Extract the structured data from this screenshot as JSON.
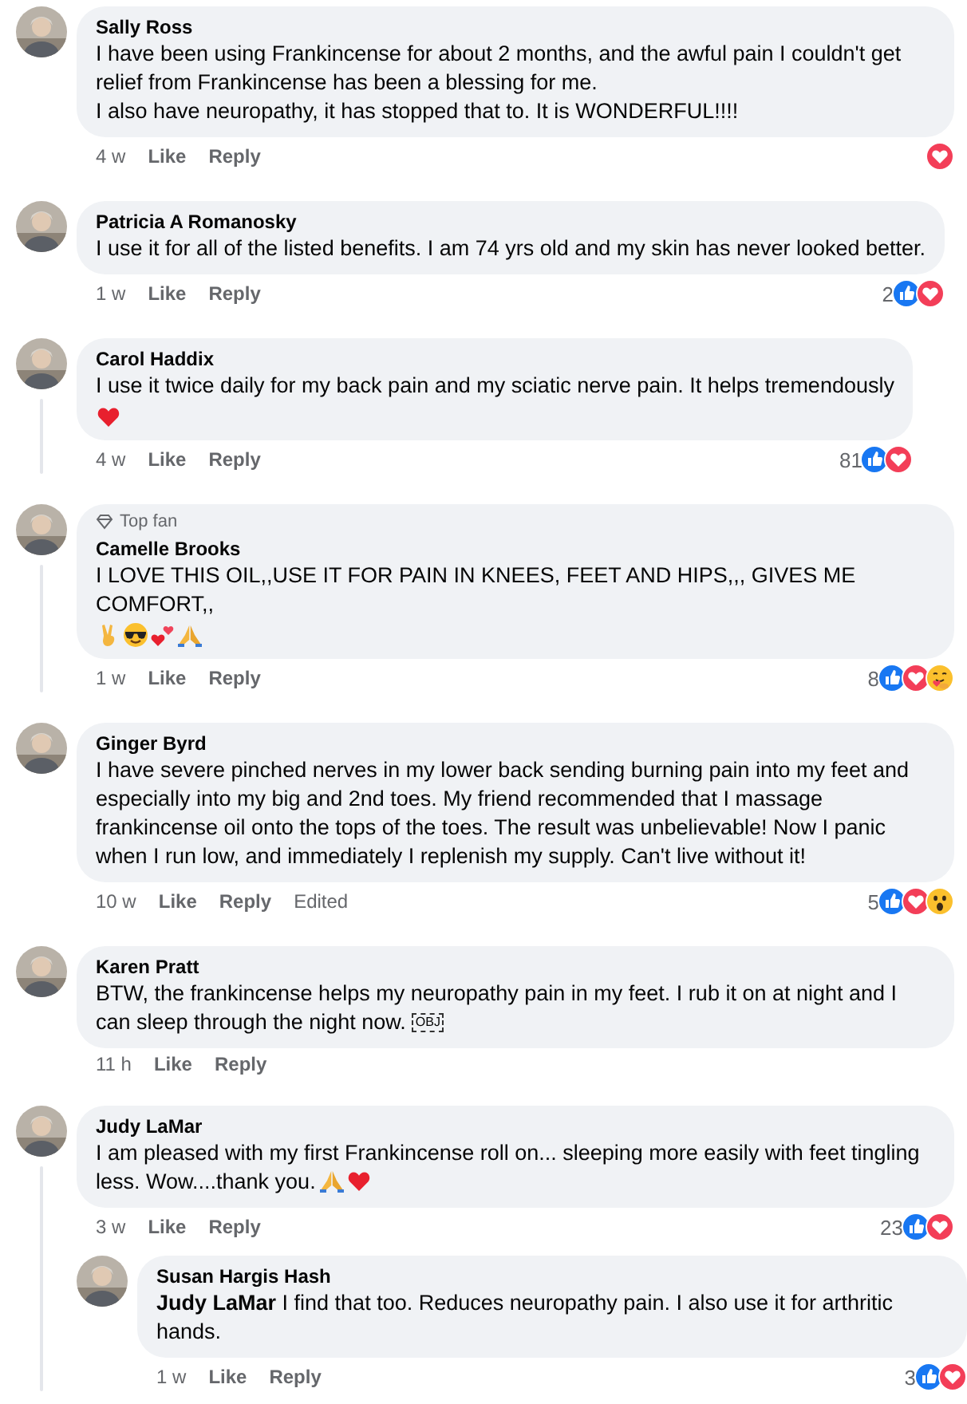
{
  "comments": [
    {
      "name": "Sally Ross",
      "text": "I have been using Frankincense for about 2 months, and the awful pain I couldn't get relief from Frankincense has been a blessing for me.\nI also have neuropathy, it has stopped that to. It is WONDERFUL!!!!",
      "time": "4 w",
      "like": "Like",
      "reply": "Reply",
      "reactions": [
        {
          "kind": "love"
        }
      ],
      "thread_line": false
    },
    {
      "name": "Patricia A Romanosky",
      "text": "I use it for all of the listed benefits. I am 74 yrs old and my skin has never looked better.",
      "time": "1 w",
      "like": "Like",
      "reply": "Reply",
      "count": "2",
      "reactions": [
        {
          "kind": "like"
        },
        {
          "kind": "love"
        }
      ],
      "thread_line": false
    },
    {
      "name": "Carol Haddix",
      "text": "I use it twice daily for my back pain and my sciatic nerve pain. It helps tremendously",
      "emojis": [
        {
          "kind": "heart"
        }
      ],
      "time": "4 w",
      "like": "Like",
      "reply": "Reply",
      "count": "81",
      "reactions": [
        {
          "kind": "like"
        },
        {
          "kind": "love"
        }
      ],
      "thread_line": true
    },
    {
      "badge": "Top fan",
      "name": "Camelle Brooks",
      "text": "I LOVE THIS OIL,,USE IT FOR PAIN IN KNEES, FEET AND HIPS,,, GIVES ME COMFORT,,",
      "emojis": [
        {
          "kind": "victory"
        },
        {
          "kind": "sunglasses"
        },
        {
          "kind": "hearts"
        },
        {
          "kind": "pray"
        }
      ],
      "time": "1 w",
      "like": "Like",
      "reply": "Reply",
      "count": "8",
      "reactions": [
        {
          "kind": "like"
        },
        {
          "kind": "love"
        },
        {
          "kind": "care"
        }
      ],
      "thread_line": true
    },
    {
      "name": "Ginger Byrd",
      "text": "I have severe pinched nerves in my lower back sending burning pain into my feet and especially into my big and 2nd toes. My friend recommended that I massage frankincense oil onto the tops of the toes. The result was unbelievable! Now I panic when I run low, and immediately I replenish my supply. Can't live without it!",
      "time": "10 w",
      "like": "Like",
      "reply": "Reply",
      "edited": "Edited",
      "count": "5",
      "reactions": [
        {
          "kind": "like"
        },
        {
          "kind": "love"
        },
        {
          "kind": "wow"
        }
      ],
      "thread_line": false
    },
    {
      "name": "Karen Pratt",
      "text": "BTW, the frankincense helps my neuropathy pain in my feet. I rub it on at night and I can sleep through the night now.",
      "object_mark": "OBJ",
      "time": "11 h",
      "like": "Like",
      "reply": "Reply",
      "thread_line": false
    },
    {
      "name": "Judy LaMar",
      "text": "I am pleased with my first Frankincense roll on... sleeping more easily with feet tingling less. Wow....thank you.",
      "inline_emojis": [
        {
          "kind": "pray"
        },
        {
          "kind": "heart"
        }
      ],
      "time": "3 w",
      "like": "Like",
      "reply": "Reply",
      "count": "23",
      "reactions": [
        {
          "kind": "like"
        },
        {
          "kind": "love"
        }
      ],
      "thread_line": true,
      "children": [
        {
          "name": "Susan Hargis Hash",
          "text": "**Judy LaMar** I find that too. Reduces neuropathy pain. I also use it for arthritic hands.",
          "time": "1 w",
          "like": "Like",
          "reply": "Reply",
          "count": "3",
          "reactions": [
            {
              "kind": "like"
            },
            {
              "kind": "love"
            }
          ],
          "thread_line": false
        }
      ]
    }
  ]
}
